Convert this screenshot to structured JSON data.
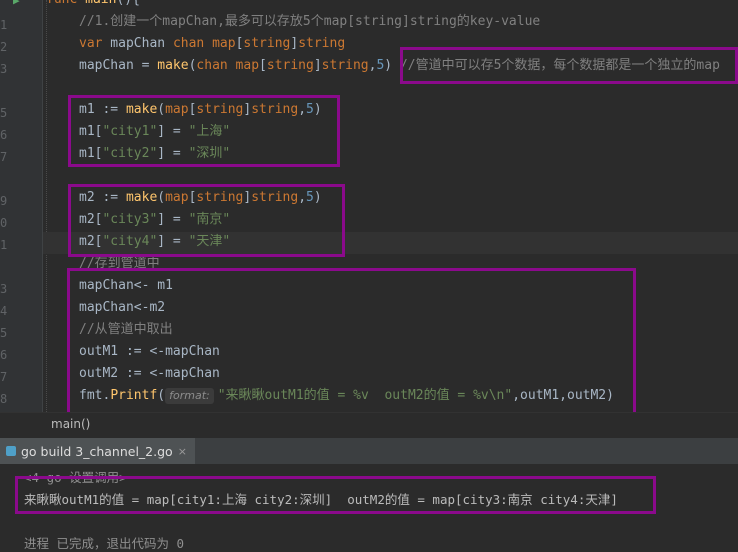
{
  "editor": {
    "line_numbers": [
      "",
      "",
      "",
      "",
      "",
      "",
      "",
      "",
      "",
      "",
      "",
      "",
      "",
      "",
      "",
      "",
      "",
      "",
      ""
    ],
    "header": "func main(){",
    "lines": [
      {
        "comment": "//1.创建一个mapChan,最多可以存放5个map[string]string的key-value"
      },
      {
        "kw1": "var",
        "name": " mapChan ",
        "kw2": "chan",
        "t1": " map",
        "b1": "[",
        "kw3": "string",
        "b2": "]",
        "kw4": "string"
      },
      {
        "pre": "mapChan = ",
        "fn": "make",
        "p1": "(",
        "kw1": "chan",
        "t1": " map",
        "b1": "[",
        "kw2": "string",
        "b2": "]",
        "kw3": "string",
        "comma": ",",
        "num": "5",
        "p2": ")",
        "comment": " //管道中可以存5个数据，每个数据都是一个独立的map"
      },
      {
        "pre": "m1 := ",
        "fn": "make",
        "p1": "(",
        "t1": "map",
        "b1": "[",
        "kw1": "string",
        "b2": "]",
        "kw2": "string",
        "comma": ",",
        "num": "5",
        "p2": ")"
      },
      {
        "pre": "m1[",
        "str1": "\"city1\"",
        "mid": "] = ",
        "str2": "\"上海\""
      },
      {
        "pre": "m1[",
        "str1": "\"city2\"",
        "mid": "] = ",
        "str2": "\"深圳\""
      },
      {
        "pre": "m2 := ",
        "fn": "make",
        "p1": "(",
        "t1": "map",
        "b1": "[",
        "kw1": "string",
        "b2": "]",
        "kw2": "string",
        "comma": ",",
        "num": "5",
        "p2": ")"
      },
      {
        "pre": "m2[",
        "str1": "\"city3\"",
        "mid": "] = ",
        "str2": "\"南京\""
      },
      {
        "pre": "m2[",
        "str1": "\"city4\"",
        "mid": "] = ",
        "str2": "\"天津\""
      },
      {
        "comment": "//存到管道中"
      },
      {
        "text": "mapChan<- m1"
      },
      {
        "text": "mapChan<-m2"
      },
      {
        "comment": "//从管道中取出"
      },
      {
        "text": "outM1 := <-mapChan"
      },
      {
        "text": "outM2 := <-mapChan"
      },
      {
        "pre": "fmt.",
        "fn": "Printf",
        "p1": "(",
        "hint": "format:",
        "str": "\"来瞅瞅outM1的值 = %v  outM2的值 = %v\\n\"",
        "post": ",outM1,outM2)"
      }
    ]
  },
  "breadcrumb": "main()",
  "run_panel": {
    "tab_label": "go build 3_channel_2.go",
    "tab_close": "×",
    "lines": [
      "<4 go 设置调用>",
      "来瞅瞅outM1的值 = map[city1:上海 city2:深圳]  outM2的值 = map[city3:南京 city4:天津]",
      "",
      "进程 已完成，退出代码为 0"
    ]
  },
  "colors": {
    "annotation_box": "#8b0a8c",
    "keyword": "#cc7832",
    "function": "#ffc66d",
    "string": "#6a8759",
    "number": "#6897bb",
    "comment": "#808080"
  }
}
